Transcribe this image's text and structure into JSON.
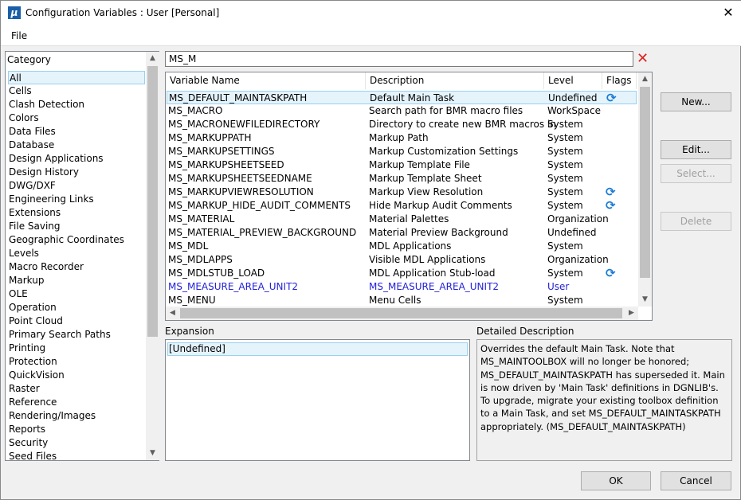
{
  "window": {
    "title": "Configuration Variables : User [Personal]",
    "close": "✕"
  },
  "menu": {
    "file": "File"
  },
  "category": {
    "header": "Category",
    "items": [
      "All",
      "Cells",
      "Clash Detection",
      "Colors",
      "Data Files",
      "Database",
      "Design Applications",
      "Design History",
      "DWG/DXF",
      "Engineering Links",
      "Extensions",
      "File Saving",
      "Geographic Coordinates",
      "Levels",
      "Macro Recorder",
      "Markup",
      "OLE",
      "Operation",
      "Point Cloud",
      "Primary Search Paths",
      "Printing",
      "Protection",
      "QuickVision",
      "Raster",
      "Reference",
      "Rendering/Images",
      "Reports",
      "Security",
      "Seed Files"
    ],
    "selected": "All"
  },
  "search": {
    "value": "MS_M",
    "clear": "✕"
  },
  "table": {
    "columns": [
      "Variable Name",
      "Description",
      "Level",
      "Flags"
    ],
    "rows": [
      {
        "name": "MS_DEFAULT_MAINTASKPATH",
        "desc": "Default Main Task",
        "level": "Undefined",
        "flag": true,
        "selected": true
      },
      {
        "name": "MS_MACRO",
        "desc": "Search path for BMR macro files",
        "level": "WorkSpace"
      },
      {
        "name": "MS_MACRONEWFILEDIRECTORY",
        "desc": "Directory to create new BMR macros in",
        "level": "System"
      },
      {
        "name": "MS_MARKUPPATH",
        "desc": "Markup Path",
        "level": "System"
      },
      {
        "name": "MS_MARKUPSETTINGS",
        "desc": "Markup Customization Settings",
        "level": "System"
      },
      {
        "name": "MS_MARKUPSHEETSEED",
        "desc": "Markup Template File",
        "level": "System"
      },
      {
        "name": "MS_MARKUPSHEETSEEDNAME",
        "desc": "Markup Template Sheet",
        "level": "System"
      },
      {
        "name": "MS_MARKUPVIEWRESOLUTION",
        "desc": "Markup View Resolution",
        "level": "System",
        "flag": true
      },
      {
        "name": "MS_MARKUP_HIDE_AUDIT_COMMENTS",
        "desc": "Hide Markup Audit Comments",
        "level": "System",
        "flag": true
      },
      {
        "name": "MS_MATERIAL",
        "desc": "Material Palettes",
        "level": "Organization"
      },
      {
        "name": "MS_MATERIAL_PREVIEW_BACKGROUND",
        "desc": "Material Preview Background",
        "level": "Undefined"
      },
      {
        "name": "MS_MDL",
        "desc": "MDL Applications",
        "level": "System"
      },
      {
        "name": "MS_MDLAPPS",
        "desc": "Visible MDL Applications",
        "level": "Organization"
      },
      {
        "name": "MS_MDLSTUB_LOAD",
        "desc": "MDL Application Stub-load",
        "level": "System",
        "flag": true
      },
      {
        "name": "MS_MEASURE_AREA_UNIT2",
        "desc": "MS_MEASURE_AREA_UNIT2",
        "level": "User",
        "user": true
      },
      {
        "name": "MS_MENU",
        "desc": "Menu Cells",
        "level": "System"
      }
    ]
  },
  "expansion": {
    "label": "Expansion",
    "value": "[Undefined]"
  },
  "detail": {
    "label": "Detailed Description",
    "text": "Overrides the default Main Task. Note that MS_MAINTOOLBOX will no longer be honored; MS_DEFAULT_MAINTASKPATH has superseded it. Main is now driven by 'Main Task' definitions in DGNLIB's. To upgrade, migrate your existing toolbox definition to a Main Task, and set MS_DEFAULT_MAINTASKPATH appropriately. (MS_DEFAULT_MAINTASKPATH)"
  },
  "buttons": {
    "new": "New...",
    "edit": "Edit...",
    "select": "Select...",
    "delete": "Delete",
    "ok": "OK",
    "cancel": "Cancel"
  },
  "colors": {
    "user_level": "#2323d8",
    "flag": "#1c7cd6",
    "selection": "#e5f3fb"
  }
}
